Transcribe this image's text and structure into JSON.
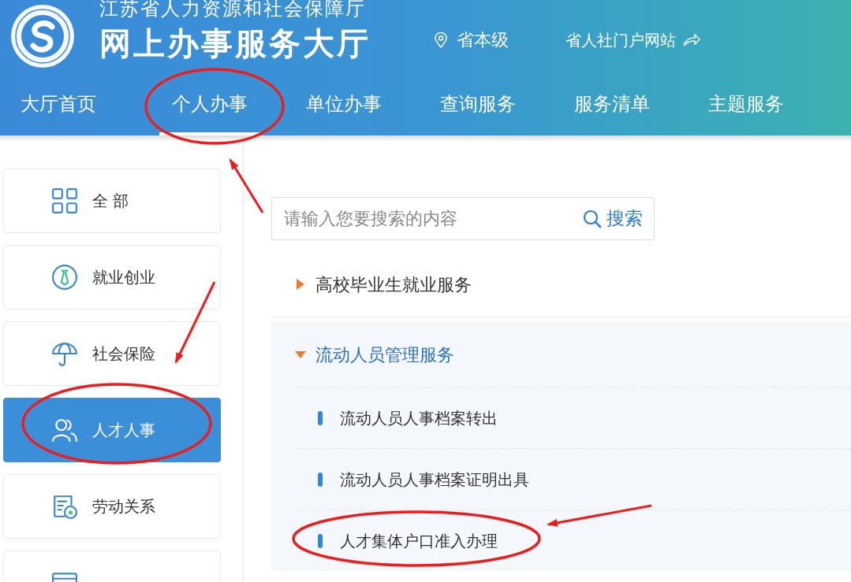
{
  "header": {
    "org_name": "江苏省人力资源和社会保障厅",
    "site_title": "网上办事服务大厅",
    "region": "省本级",
    "portal_link": "省人社门户网站"
  },
  "nav": [
    {
      "label": "大厅首页",
      "selected": false
    },
    {
      "label": "个人办事",
      "selected": true
    },
    {
      "label": "单位办事",
      "selected": false
    },
    {
      "label": "查询服务",
      "selected": false
    },
    {
      "label": "服务清单",
      "selected": false
    },
    {
      "label": "主题服务",
      "selected": false
    }
  ],
  "sidebar": [
    {
      "label": "全 部",
      "kind": "grid",
      "selected": false
    },
    {
      "label": "就业创业",
      "kind": "tie",
      "selected": false
    },
    {
      "label": "社会保险",
      "kind": "umbrella",
      "selected": false
    },
    {
      "label": "人才人事",
      "kind": "people",
      "selected": true
    },
    {
      "label": "劳动关系",
      "kind": "document",
      "selected": false
    },
    {
      "kind": "card",
      "selected": false
    }
  ],
  "search": {
    "placeholder": "请输入您要搜索的内容",
    "button": "搜索"
  },
  "categories": [
    {
      "label": "高校毕业生就业服务",
      "expanded": false
    },
    {
      "label": "流动人员管理服务",
      "expanded": true,
      "children": [
        {
          "label": "流动人员人事档案转出"
        },
        {
          "label": "流动人员人事档案证明出具"
        },
        {
          "label": "人才集体户口准入办理"
        }
      ]
    }
  ]
}
